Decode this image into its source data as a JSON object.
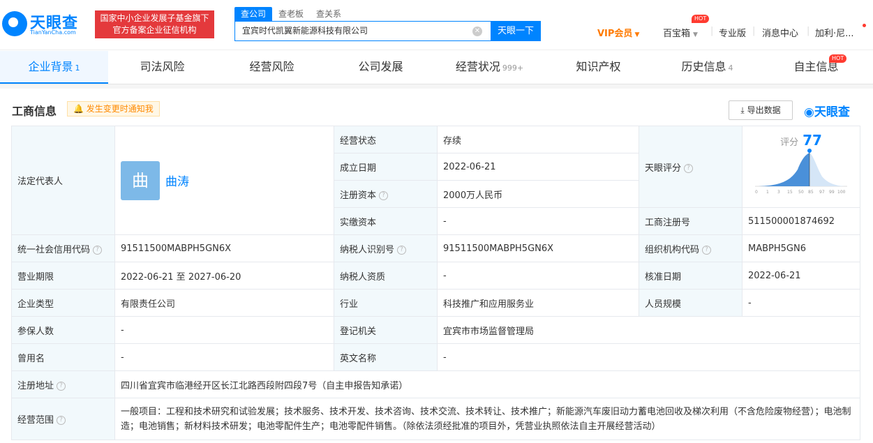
{
  "header": {
    "logo_cn": "天眼查",
    "logo_en": "TianYanCha.com",
    "badge_line1": "国家中小企业发展子基金旗下",
    "badge_line2": "官方备案企业征信机构",
    "search_tabs": [
      "查公司",
      "查老板",
      "查关系"
    ],
    "search_value": "宜宾时代凯翼新能源科技有限公司",
    "search_button": "天眼一下",
    "nav": {
      "vip": "VIP会员",
      "treasure": "百宝箱",
      "hot": "HOT",
      "pro": "专业版",
      "messages": "消息中心",
      "user": "加利·尼..."
    }
  },
  "tabs": [
    {
      "label": "企业背景",
      "count": "1"
    },
    {
      "label": "司法风险",
      "count": ""
    },
    {
      "label": "经营风险",
      "count": ""
    },
    {
      "label": "公司发展",
      "count": ""
    },
    {
      "label": "经营状况",
      "count": "999+"
    },
    {
      "label": "知识产权",
      "count": ""
    },
    {
      "label": "历史信息",
      "count": "4"
    },
    {
      "label": "自主信息",
      "count": ""
    }
  ],
  "tab_hot": "HOT",
  "section": {
    "title": "工商信息",
    "notify": "发生变更时通知我",
    "export": "导出数据",
    "brand": "天眼查"
  },
  "info": {
    "legal_rep_label": "法定代表人",
    "legal_rep_avatar": "曲",
    "legal_rep_name": "曲涛",
    "status_label": "经营状态",
    "status": "存续",
    "found_label": "成立日期",
    "found": "2022-06-21",
    "reg_cap_label": "注册资本",
    "reg_cap": "2000万人民币",
    "paid_cap_label": "实缴资本",
    "paid_cap": "-",
    "score_label": "天眼评分",
    "score_text": "评分",
    "score": "77",
    "score_ticks": [
      "0",
      "1",
      "3",
      "15",
      "50",
      "85",
      "97",
      "99",
      "100"
    ],
    "reg_no_label": "工商注册号",
    "reg_no": "511500001874692",
    "credit_label": "统一社会信用代码",
    "credit": "91511500MABPH5GN6X",
    "taxpayer_label": "纳税人识别号",
    "taxpayer": "91511500MABPH5GN6X",
    "org_label": "组织机构代码",
    "org": "MABPH5GN6",
    "term_label": "营业期限",
    "term": "2022-06-21 至 2027-06-20",
    "tax_qual_label": "纳税人资质",
    "tax_qual": "-",
    "approve_label": "核准日期",
    "approve": "2022-06-21",
    "type_label": "企业类型",
    "type": "有限责任公司",
    "industry_label": "行业",
    "industry": "科技推广和应用服务业",
    "staff_label": "人员规模",
    "staff": "-",
    "insured_label": "参保人数",
    "insured": "-",
    "authority_label": "登记机关",
    "authority": "宜宾市市场监督管理局",
    "former_label": "曾用名",
    "former": "-",
    "en_label": "英文名称",
    "en": "-",
    "address_label": "注册地址",
    "address": "四川省宜宾市临港经开区长江北路西段附四段7号（自主申报告知承诺）",
    "scope_label": "经营范围",
    "scope": "一般项目：工程和技术研究和试验发展；技术服务、技术开发、技术咨询、技术交流、技术转让、技术推广；新能源汽车废旧动力蓄电池回收及梯次利用（不含危险废物经营）；电池制造；电池销售；新材料技术研发；电池零配件生产；电池零配件销售。（除依法须经批准的项目外，凭营业执照依法自主开展经营活动）"
  },
  "colors": {
    "accent": "#0084ff",
    "badge": "#e4393c",
    "vip": "#ff7a00",
    "label_bg": "#f2f9fc"
  }
}
